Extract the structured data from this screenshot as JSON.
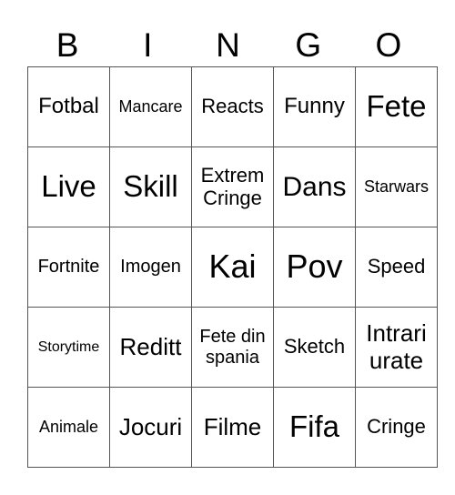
{
  "header": {
    "letters": [
      "B",
      "I",
      "N",
      "G",
      "O"
    ]
  },
  "board": {
    "rows": [
      [
        "Fotbal",
        "Mancare",
        "Reacts",
        "Funny",
        "Fete"
      ],
      [
        "Live",
        "Skill",
        "Extrem Cringe",
        "Dans",
        "Starwars"
      ],
      [
        "Fortnite",
        "Imogen",
        "Kai",
        "Pov",
        "Speed"
      ],
      [
        "Storytime",
        "Reditt",
        "Fete din spania",
        "Sketch",
        "Intrari urate"
      ],
      [
        "Animale",
        "Jocuri",
        "Filme",
        "Fifa",
        "Cringe"
      ]
    ]
  }
}
